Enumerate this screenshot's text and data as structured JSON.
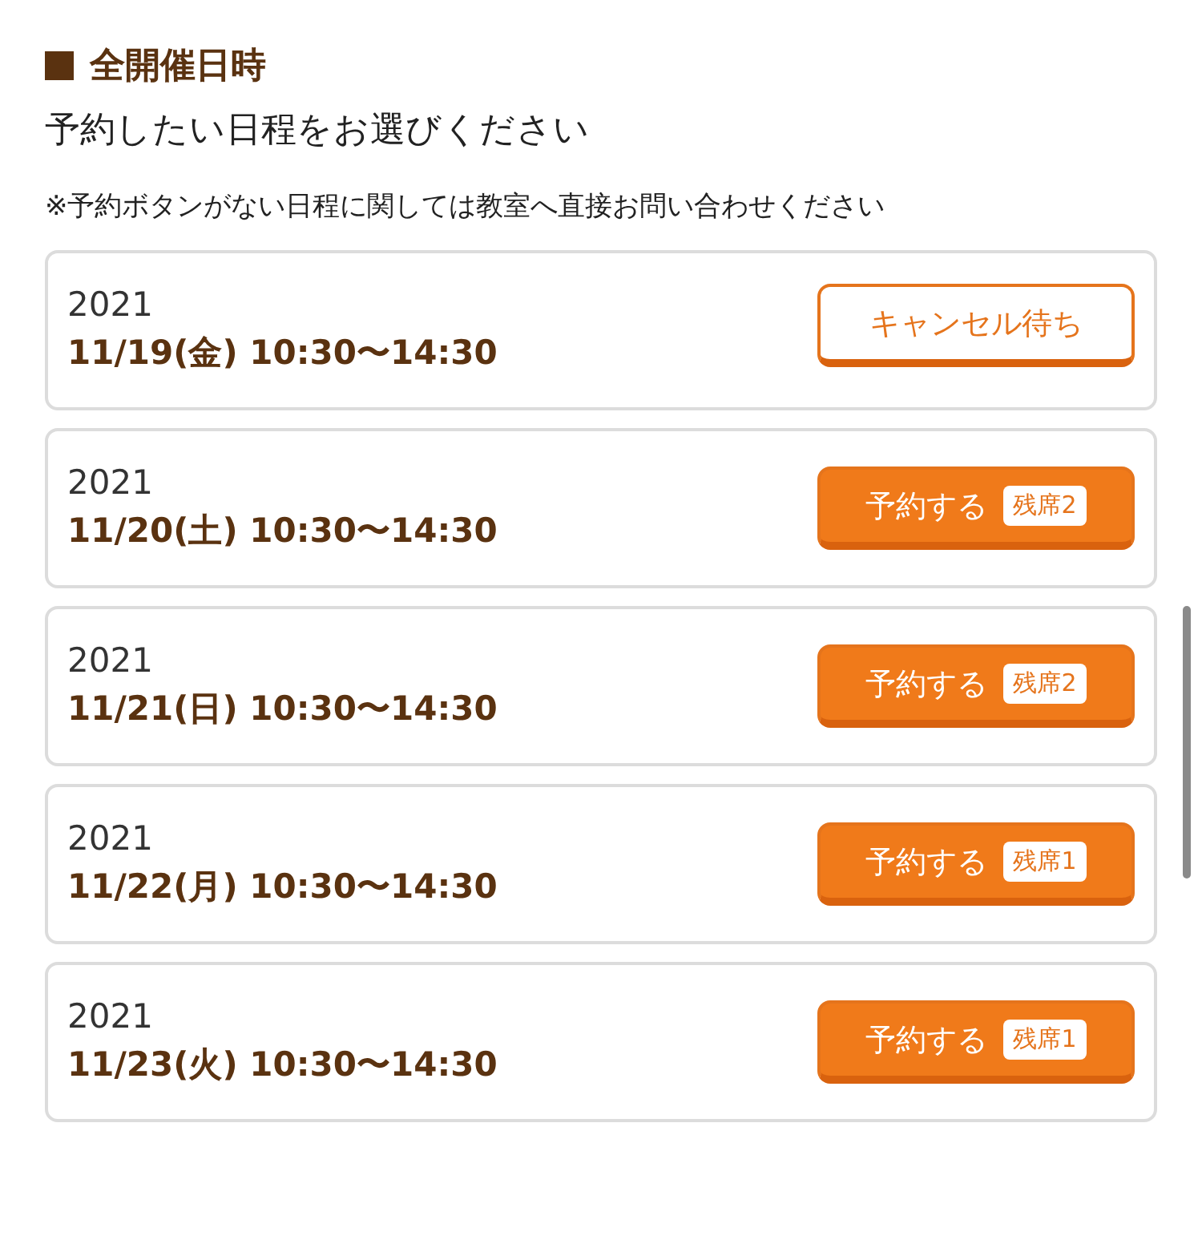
{
  "section": {
    "title": "全開催日時",
    "subtitle": "予約したい日程をお選びください",
    "note": "※予約ボタンがない日程に関しては教室へ直接お問い合わせください"
  },
  "schedules": [
    {
      "year": "2021",
      "datetime": "11/19(金) 10:30〜14:30",
      "button": {
        "kind": "waitlist",
        "label": "キャンセル待ち"
      }
    },
    {
      "year": "2021",
      "datetime": "11/20(土) 10:30〜14:30",
      "button": {
        "kind": "reserve",
        "label": "予約する",
        "badge": "残席2"
      }
    },
    {
      "year": "2021",
      "datetime": "11/21(日) 10:30〜14:30",
      "button": {
        "kind": "reserve",
        "label": "予約する",
        "badge": "残席2"
      }
    },
    {
      "year": "2021",
      "datetime": "11/22(月) 10:30〜14:30",
      "button": {
        "kind": "reserve",
        "label": "予約する",
        "badge": "残席1"
      }
    },
    {
      "year": "2021",
      "datetime": "11/23(火) 10:30〜14:30",
      "button": {
        "kind": "reserve",
        "label": "予約する",
        "badge": "残席1"
      }
    }
  ]
}
